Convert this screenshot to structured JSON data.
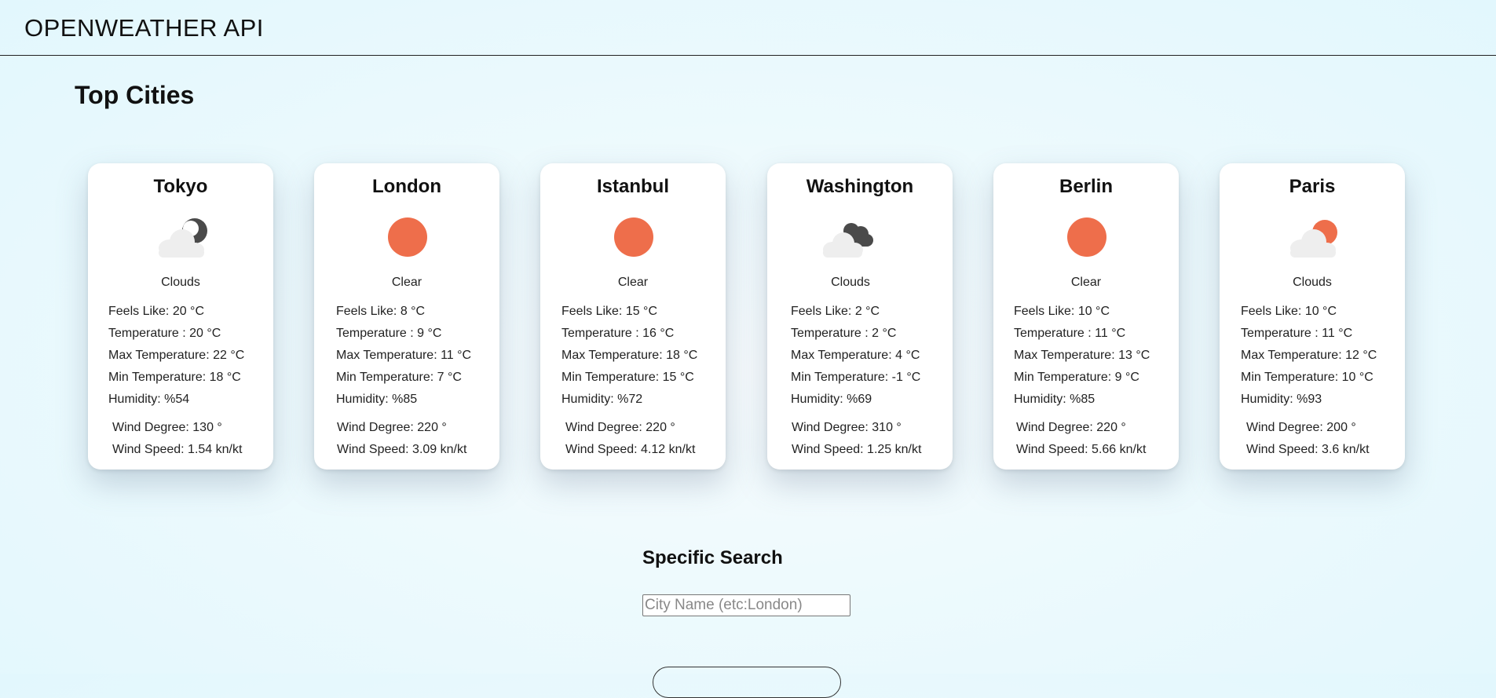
{
  "header": {
    "title": "OPENWEATHER API"
  },
  "top_cities": {
    "title": "Top Cities",
    "cards": [
      {
        "city": "Tokyo",
        "icon": "cloud-moon-icon",
        "description": "Clouds",
        "feels_like": "Feels Like: 20 °C",
        "temperature": "Temperature : 20 °C",
        "max_temp": "Max Temperature: 22 °C",
        "min_temp": "Min Temperature: 18 °C",
        "humidity": "Humidity: %54",
        "wind_degree": "Wind Degree: 130 °",
        "wind_speed": "Wind Speed: 1.54 kn/kt"
      },
      {
        "city": "London",
        "icon": "sun-icon",
        "description": "Clear",
        "feels_like": "Feels Like: 8 °C",
        "temperature": "Temperature : 9 °C",
        "max_temp": "Max Temperature: 11 °C",
        "min_temp": "Min Temperature: 7 °C",
        "humidity": "Humidity: %85",
        "wind_degree": "Wind Degree: 220 °",
        "wind_speed": "Wind Speed: 3.09 kn/kt"
      },
      {
        "city": "Istanbul",
        "icon": "sun-icon",
        "description": "Clear",
        "feels_like": "Feels Like: 15 °C",
        "temperature": "Temperature : 16 °C",
        "max_temp": "Max Temperature: 18 °C",
        "min_temp": "Min Temperature: 15 °C",
        "humidity": "Humidity: %72",
        "wind_degree": "Wind Degree: 220 °",
        "wind_speed": "Wind Speed: 4.12 kn/kt"
      },
      {
        "city": "Washington",
        "icon": "dark-clouds-icon",
        "description": "Clouds",
        "feels_like": "Feels Like: 2 °C",
        "temperature": "Temperature : 2 °C",
        "max_temp": "Max Temperature: 4 °C",
        "min_temp": "Min Temperature: -1 °C",
        "humidity": "Humidity: %69",
        "wind_degree": "Wind Degree: 310 °",
        "wind_speed": "Wind Speed: 1.25 kn/kt"
      },
      {
        "city": "Berlin",
        "icon": "sun-icon",
        "description": "Clear",
        "feels_like": "Feels Like: 10 °C",
        "temperature": "Temperature : 11 °C",
        "max_temp": "Max Temperature: 13 °C",
        "min_temp": "Min Temperature: 9 °C",
        "humidity": "Humidity: %85",
        "wind_degree": "Wind Degree: 220 °",
        "wind_speed": "Wind Speed: 5.66 kn/kt"
      },
      {
        "city": "Paris",
        "icon": "cloud-sun-icon",
        "description": "Clouds",
        "feels_like": "Feels Like: 10 °C",
        "temperature": "Temperature : 11 °C",
        "max_temp": "Max Temperature: 12 °C",
        "min_temp": "Min Temperature: 10 °C",
        "humidity": "Humidity: %93",
        "wind_degree": "Wind Degree: 200 °",
        "wind_speed": "Wind Speed: 3.6 kn/kt"
      }
    ]
  },
  "search": {
    "title": "Specific Search",
    "input_value": "",
    "placeholder": "City Name (etc:London)"
  },
  "colors": {
    "sun": "#ee6e4b",
    "dark_cloud": "#4a4a4a",
    "light_cloud": "#eeeeee"
  }
}
